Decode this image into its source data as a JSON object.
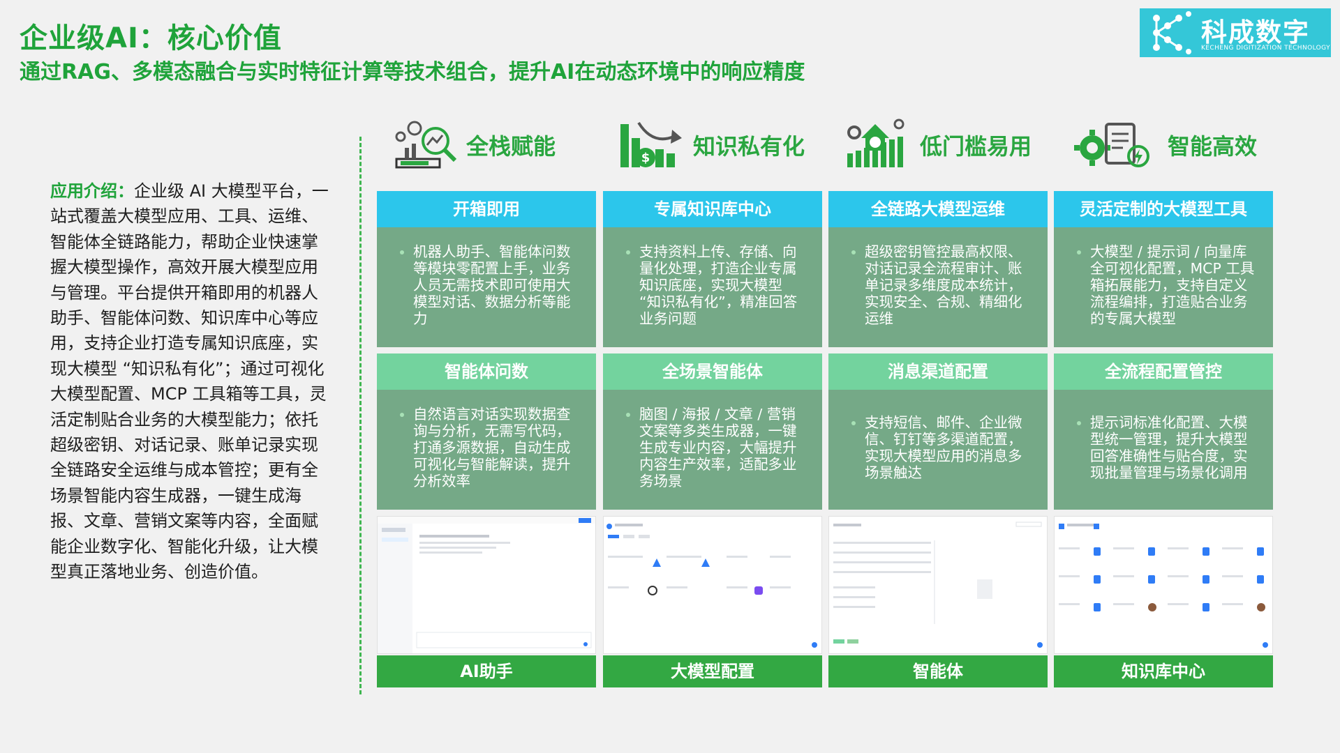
{
  "header": {
    "title": "企业级AI：核心价值",
    "subtitle": "通过RAG、多模态融合与实时特征计算等技术组合，提升AI在动态环境中的响应精度"
  },
  "logo": {
    "name": "科成数字",
    "tagline": "KECHENG DIGITIZATION TECHNOLOGY"
  },
  "intro": {
    "label": "应用介绍：",
    "text": "企业级 AI 大模型平台，一站式覆盖大模型应用、工具、运维、智能体全链路能力，帮助企业快速掌握大模型操作，高效开展大模型应用与管理。平台提供开箱即用的机器人助手、智能体问数、知识库中心等应用，支持企业打造专属知识底座，实现大模型 “知识私有化”；通过可视化大模型配置、MCP 工具箱等工具，灵活定制贴合业务的大模型能力；依托超级密钥、对话记录、账单记录实现全链路安全运维与成本管控；更有全场景智能内容生成器，一键生成海报、文章、营销文案等内容，全面赋能企业数字化、智能化升级，让大模型真正落地业务、创造价值。"
  },
  "features": [
    {
      "label": "全栈赋能",
      "icon": "analytics-gear-icon"
    },
    {
      "label": "知识私有化",
      "icon": "money-growth-icon"
    },
    {
      "label": "低门槛易用",
      "icon": "house-coin-gear-icon"
    },
    {
      "label": "智能高效",
      "icon": "gear-document-icon"
    }
  ],
  "cards_top": [
    {
      "title": "开箱即用",
      "text": "机器人助手、智能体问数等模块零配置上手，业务人员无需技术即可使用大模型对话、数据分析等能力"
    },
    {
      "title": "专属知识库中心",
      "text": "支持资料上传、存储、向量化处理，打造企业专属知识底座，实现大模型 “知识私有化”，精准回答业务问题"
    },
    {
      "title": "全链路大模型运维",
      "text": "超级密钥管控最高权限、对话记录全流程审计、账单记录多维度成本统计，实现安全、合规、精细化运维"
    },
    {
      "title": "灵活定制的大模型工具",
      "text": "大模型 / 提示词 / 向量库全可视化配置，MCP 工具箱拓展能力，支持自定义流程编排，打造贴合业务的专属大模型"
    }
  ],
  "cards_bottom": [
    {
      "title": "智能体问数",
      "text": "自然语言对话实现数据查询与分析，无需写代码，打通多源数据，自动生成可视化与智能解读，提升分析效率"
    },
    {
      "title": "全场景智能体",
      "text": "脑图 / 海报 / 文章 / 营销文案等多类生成器，一键生成专业内容，大幅提升内容生产效率，适配多业务场景"
    },
    {
      "title": "消息渠道配置",
      "text": "支持短信、邮件、企业微信、钉钉等多渠道配置，实现大模型应用的消息多场景触达"
    },
    {
      "title": "全流程配置管控",
      "text": "提示词标准化配置、大模型统一管理，提升大模型回答准确性与贴合度，实现批量管理与场景化调用"
    }
  ],
  "screenshots": [
    {
      "caption": "AI助手"
    },
    {
      "caption": "大模型配置"
    },
    {
      "caption": "智能体"
    },
    {
      "caption": "知识库中心"
    }
  ],
  "colors": {
    "brand_green": "#1fa33a",
    "header_cyan": "#2cc6eb",
    "header_mint": "#73d39e",
    "body_green": "#75a987",
    "caption_green": "#33a843",
    "logo_cyan": "#34c7d8"
  }
}
